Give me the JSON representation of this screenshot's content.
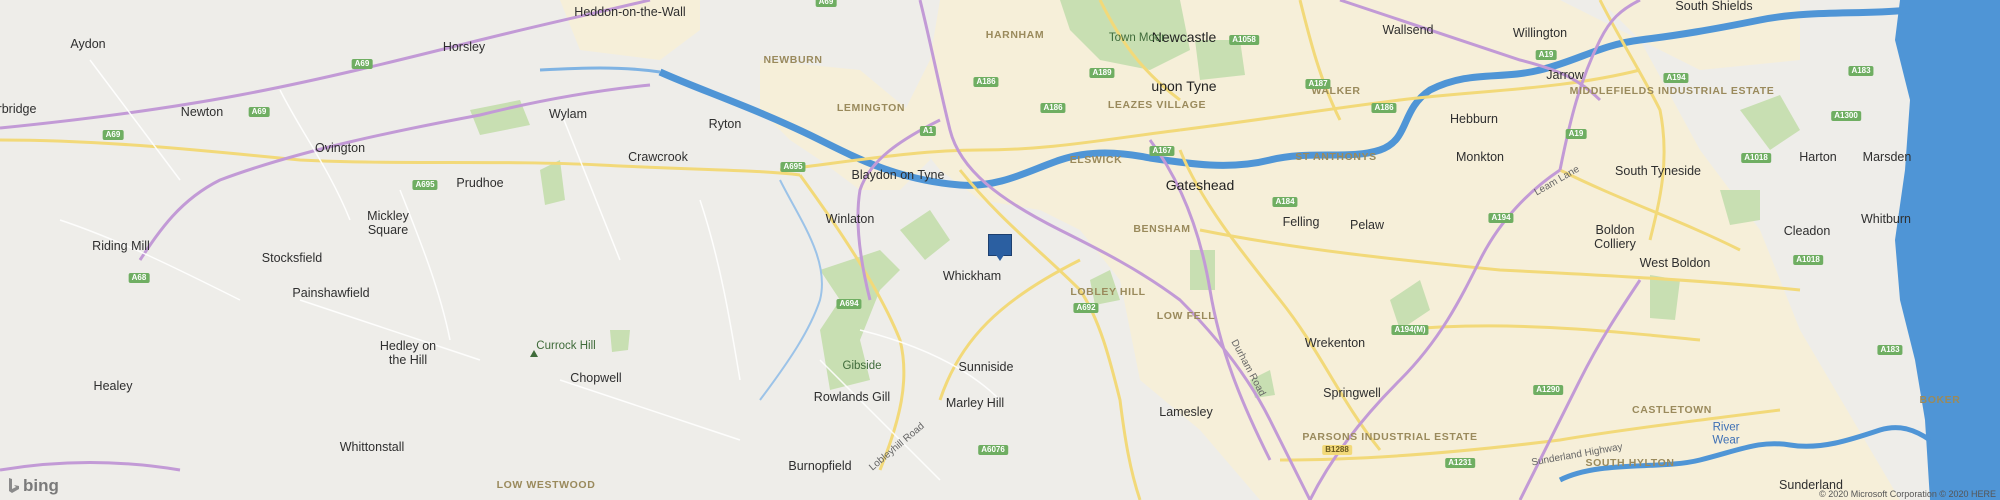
{
  "map": {
    "attribution_brand": "bing",
    "copyright": "© 2020 Microsoft Corporation © 2020 HERE",
    "marker": {
      "name": "location-pin",
      "color": "#2b5fa1"
    },
    "colors": {
      "land": "#eeede9",
      "urban": "#f7f0dc",
      "green": "#c7dfb0",
      "water": "#4f95d6",
      "motorway": "#c29ad6",
      "primary": "#f2d979"
    },
    "places": {
      "heddon": "Heddon-on-the-Wall",
      "aydon": "Aydon",
      "horsley": "Horsley",
      "corbridge": "rbridge",
      "newton": "Newton",
      "wylam": "Wylam",
      "ovington": "Ovington",
      "ryton": "Ryton",
      "crawcrook": "Crawcrook",
      "prudhoe": "Prudhoe",
      "mickley": "Mickley",
      "mickley2": "Square",
      "riding_mill": "Riding Mill",
      "stocksfield": "Stocksfield",
      "painshawfield": "Painshawfield",
      "hedley": "Hedley on",
      "hedley2": "the Hill",
      "healey": "Healey",
      "whittonstall": "Whittonstall",
      "chopwell": "Chopwell",
      "low_westwood": "LOW WESTWOOD",
      "burnopfield": "Burnopfield",
      "rowlands_gill": "Rowlands Gill",
      "winlaton": "Winlaton",
      "blaydon": "Blaydon on Tyne",
      "whickham": "Whickham",
      "sunniside": "Sunniside",
      "marley_hill": "Marley Hill",
      "lamesley": "Lamesley",
      "newcastle": "Newcastle",
      "newcastle2": "upon Tyne",
      "gateshead": "Gateshead",
      "felling": "Felling",
      "pelaw": "Pelaw",
      "wrekenton": "Wrekenton",
      "springwell": "Springwell",
      "hebburn": "Hebburn",
      "monkton": "Monkton",
      "jarrow": "Jarrow",
      "wallsend": "Wallsend",
      "willington": "Willington",
      "south_shields": "South Shields",
      "south_tyneside": "South Tyneside",
      "harton": "Harton",
      "marsden": "Marsden",
      "whitburn": "Whitburn",
      "cleadon": "Cleadon",
      "boldon": "Boldon",
      "boldon2": "Colliery",
      "west_boldon": "West Boldon",
      "sunderland": "Sunderland"
    },
    "districts": {
      "newburn": "NEWBURN",
      "lemington": "LEMINGTON",
      "harnham": "HARNHAM",
      "elswick": "ELSWICK",
      "leazes": "LEAZES VILLAGE",
      "walker": "WALKER",
      "st_anthonys": "ST ANTHONYS",
      "bensham": "BENSHAM",
      "lobley_hill": "LOBLEY HILL",
      "low_fell": "LOW FELL",
      "middlefields": "MIDDLEFIELDS INDUSTRIAL ESTATE",
      "parsons": "PARSONS INDUSTRIAL ESTATE",
      "castletown": "CASTLETOWN",
      "south_hylton": "SOUTH HYLTON",
      "boker": "BOKER"
    },
    "features": {
      "town_moor": "Town Moor",
      "currock_hill": "Currock Hill",
      "gibside": "Gibside",
      "river_wear": "River",
      "river_wear2": "Wear"
    },
    "roads": {
      "a69a": "A69",
      "a69b": "A69",
      "a69c": "A69",
      "a68a": "A68",
      "a68b": "A68",
      "a695a": "A695",
      "a695b": "A695",
      "a1": "A1",
      "a186a": "A186",
      "a186b": "A186",
      "a186c": "A186",
      "a189": "A189",
      "a167": "A167",
      "a184": "A184",
      "a187": "A187",
      "a1058": "A1058",
      "a19a": "A19",
      "a19b": "A19",
      "a194": "A194",
      "a194b": "A194",
      "a194m": "A194(M)",
      "a183a": "A183",
      "a183b": "A183",
      "a1300": "A1300",
      "a1018a": "A1018",
      "a1018b": "A1018",
      "a692": "A692",
      "a694": "A694",
      "a6076": "A6076",
      "a1290": "A1290",
      "a1231": "A1231",
      "b1288": "B1288",
      "durham_road": "Durham Road",
      "leam_lane": "Leam Lane",
      "lobleyhill_road": "Lobleyhill Road",
      "sunderland_highway": "Sunderland Highway"
    }
  }
}
